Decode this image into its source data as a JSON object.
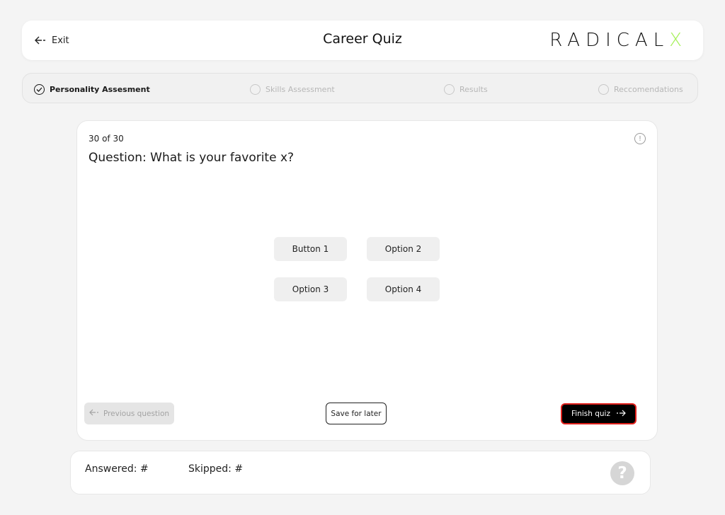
{
  "header": {
    "exit_label": "Exit",
    "title": "Career Quiz",
    "logo_main": "RADICAL",
    "logo_accent": "X"
  },
  "steps": [
    {
      "label": "Personality Assesment",
      "state": "completed"
    },
    {
      "label": "Skills Assessment",
      "state": "pending"
    },
    {
      "label": "Results",
      "state": "pending"
    },
    {
      "label": "Reccomendations",
      "state": "pending"
    }
  ],
  "quiz": {
    "counter": "30 of 30",
    "question": "Question: What is your favorite x?",
    "options": [
      "Button 1",
      "Option 2",
      "Option 3",
      "Option 4"
    ],
    "prev_label": "Previous question",
    "save_label": "Save for later",
    "finish_label": "Finish quiz"
  },
  "footer": {
    "answered": "Answered: #",
    "skipped": "Skipped: #"
  },
  "colors": {
    "accent": "#a6f05a",
    "finish_border": "#e0201c",
    "background": "#f4f4f4"
  }
}
